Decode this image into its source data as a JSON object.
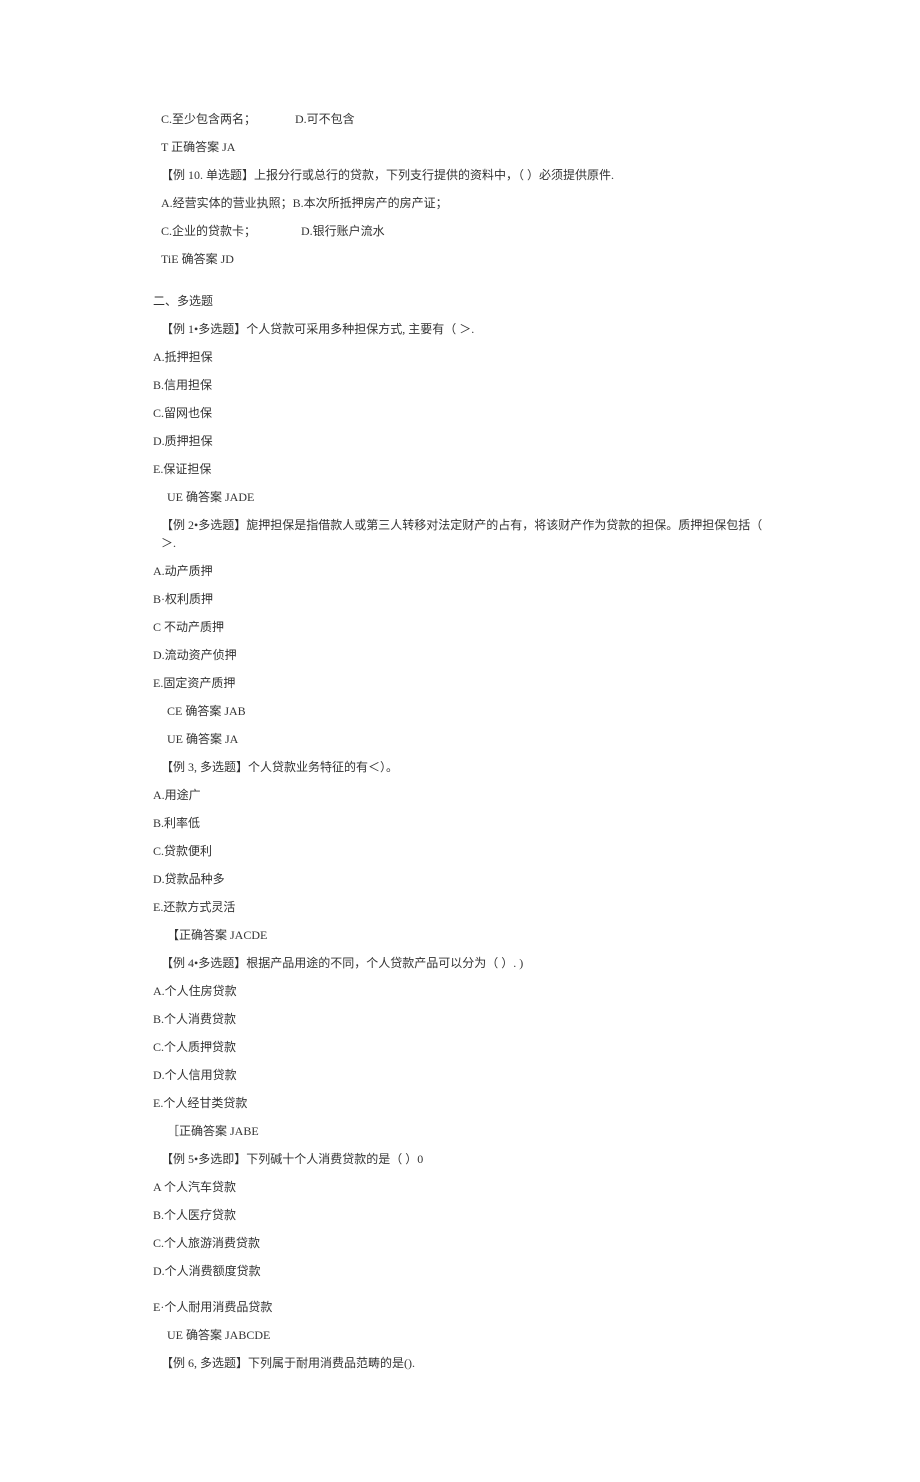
{
  "top": {
    "lineCD": {
      "c": "C.至少包含两名；",
      "d": "D.可不包含"
    },
    "ans9": "T 正确答案 JA",
    "q10": "【例 10. 单选题】上报分行或总行的贷款，下列支行提供的资料中，（ ）必须提供原件.",
    "q10AB": "A.经营实体的营业执照；B.本次所抵押房产的房产证；",
    "q10CD": {
      "c": "C.企业的贷款卡；",
      "d": "D.银行账户流水"
    },
    "ans10": "TiE 确答案 JD"
  },
  "section2": {
    "heading": "二、多选题",
    "q1": {
      "stem": "【例 1•多选题】个人贷款可采用多种担保方式, 主要有（ ＞.",
      "A": "A.抵押担保",
      "B": "B.信用担保",
      "C": "C.留网也保",
      "D": "D.质押担保",
      "E": "E.保证担保",
      "ans": "UE 确答案 JADE"
    },
    "q2": {
      "stem": "【例 2•多选题】旎押担保是指借款人或第三人转移对法定财产的占有，将该财产作为贷款的担保。质押担保包括（ ＞.",
      "A": "A.动产质押",
      "B": "B·权利质押",
      "C": "C 不动产质押",
      "D": "D.流动资产侦押",
      "E": "E.固定资产质押",
      "ans1": "CE 确答案 JAB",
      "ans2": "UE 确答案 JA"
    },
    "q3": {
      "stem": "【例 3, 多选题】个人贷款业务特征的有＜）。",
      "A": "A.用途广",
      "B": "B.利率低",
      "C": "C.贷款便利",
      "D": "D.贷款品种多",
      "E": "E.还款方式灵活",
      "ans": "【正确答案 JACDE"
    },
    "q4": {
      "stem": "【例 4•多选题】根据产品用途的不同，个人贷款产品可以分为（ ）. )",
      "A": "A.个人住房贷款",
      "B": "B.个人消费贷款",
      "C": "C.个人质押贷款",
      "D": "D.个人信用贷款",
      "E": "E.个人经甘类贷款",
      "ans": "［正确答案 JABE"
    },
    "q5": {
      "stem": "【例 5•多选即】下列碱十个人消费贷款的是（ ）0",
      "A": "A 个人汽车贷款",
      "B": "B.个人医疗贷款",
      "C": "C.个人旅游消费贷款",
      "D": "D.个人消费额度贷款",
      "E": "E·个人耐用消费品贷款",
      "ans": "UE 确答案 JABCDE"
    },
    "q6": {
      "stem": "【例 6, 多选题】下列属于耐用消费品范畴的是()."
    }
  }
}
